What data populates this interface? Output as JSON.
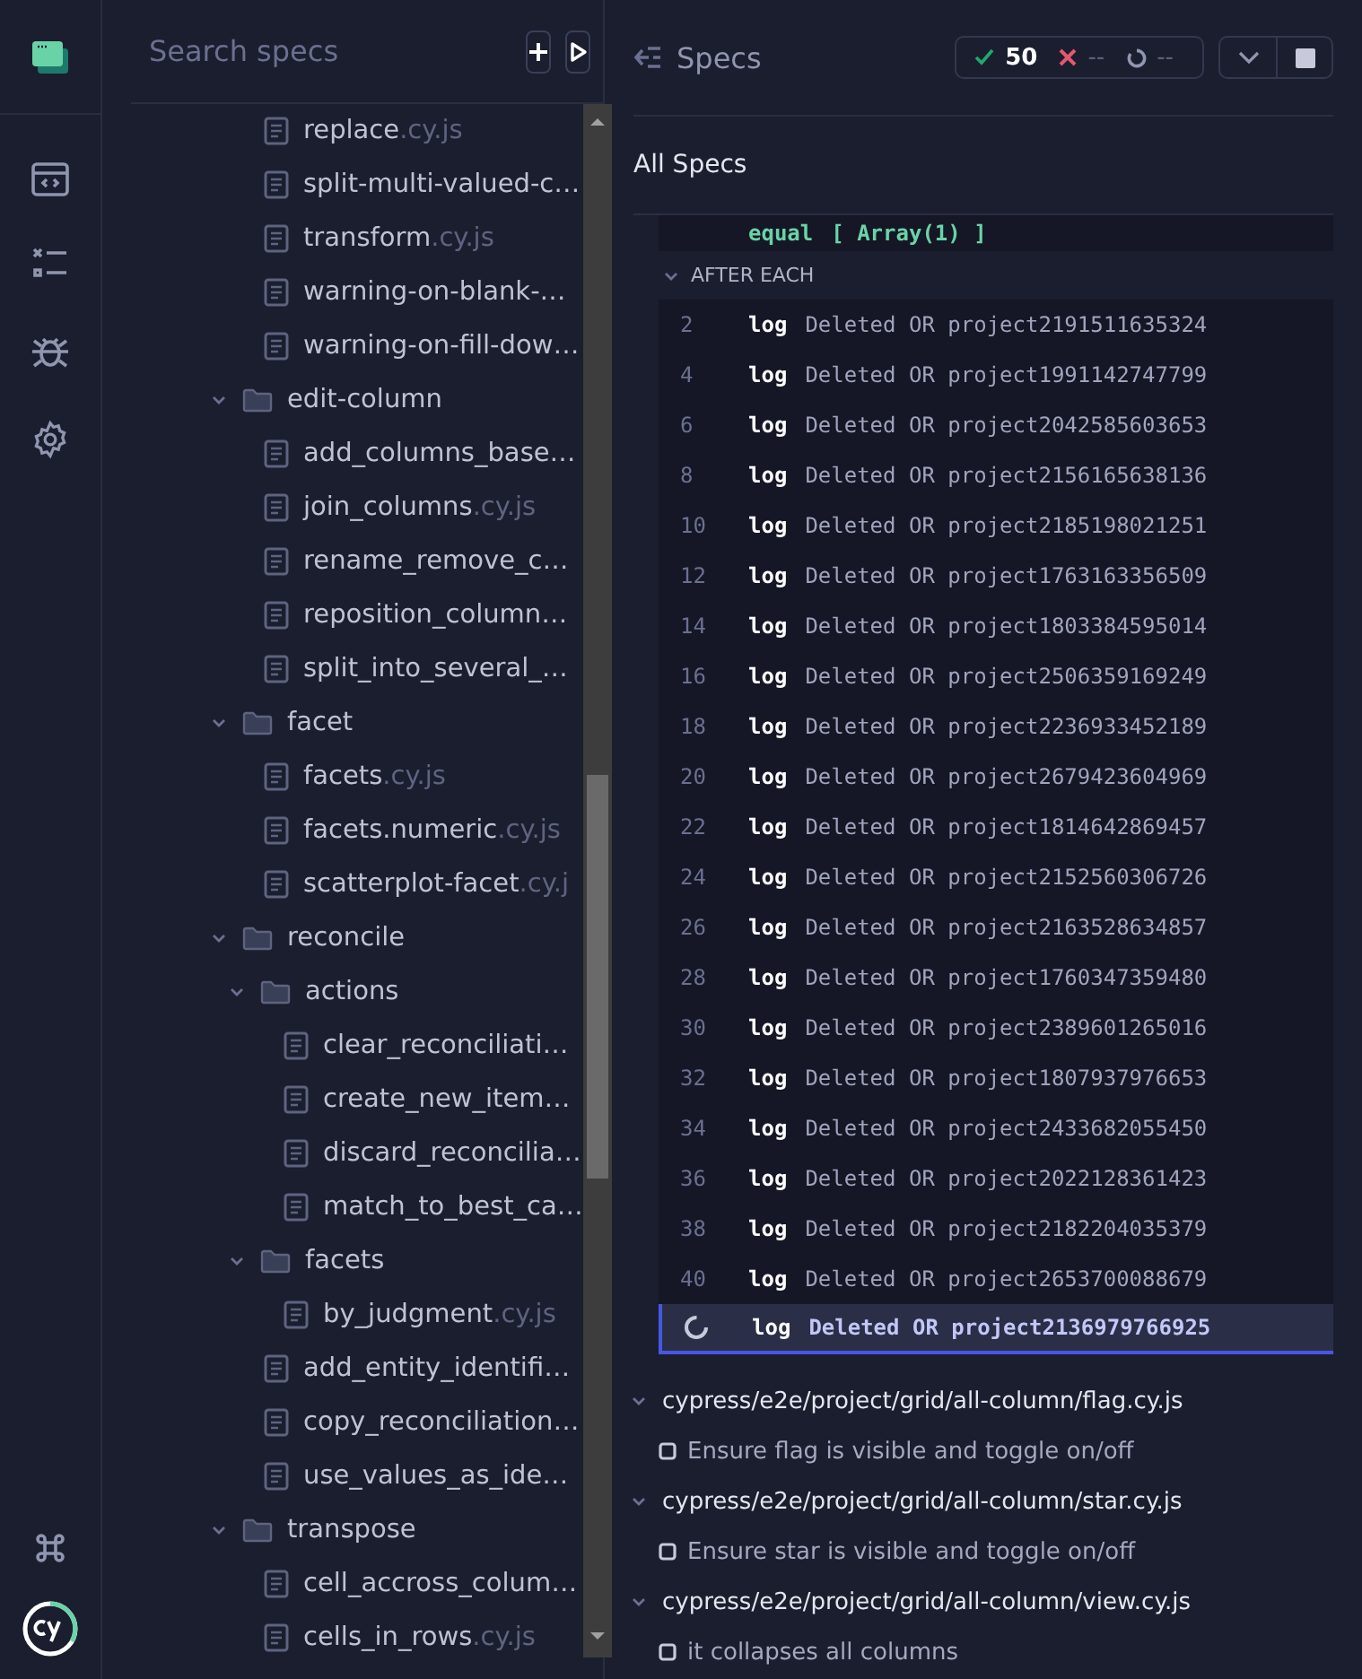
{
  "search": {
    "placeholder": "Search specs"
  },
  "tree": [
    {
      "kind": "file",
      "name": "replace",
      "ext": ".cy.js"
    },
    {
      "kind": "file",
      "name": "split-multi-valued-c…"
    },
    {
      "kind": "file",
      "name": "transform",
      "ext": ".cy.js"
    },
    {
      "kind": "file",
      "name": "warning-on-blank-…"
    },
    {
      "kind": "file",
      "name": "warning-on-fill-dow…"
    },
    {
      "kind": "folder",
      "name": "edit-column",
      "expanded": true,
      "children": [
        {
          "kind": "file",
          "name": "add_columns_base…"
        },
        {
          "kind": "file",
          "name": "join_columns",
          "ext": ".cy.js"
        },
        {
          "kind": "file",
          "name": "rename_remove_c…"
        },
        {
          "kind": "file",
          "name": "reposition_column…"
        },
        {
          "kind": "file",
          "name": "split_into_several_…"
        }
      ]
    },
    {
      "kind": "folder",
      "name": "facet",
      "expanded": true,
      "children": [
        {
          "kind": "file",
          "name": "facets",
          "ext": ".cy.js"
        },
        {
          "kind": "file",
          "name": "facets.numeric",
          "ext": ".cy.js"
        },
        {
          "kind": "file",
          "name": "scatterplot-facet",
          "ext": ".cy.j"
        }
      ]
    },
    {
      "kind": "folder",
      "name": "reconcile",
      "expanded": true,
      "children": [
        {
          "kind": "folder",
          "name": "actions",
          "expanded": true,
          "children": [
            {
              "kind": "file",
              "name": "clear_reconciliati…"
            },
            {
              "kind": "file",
              "name": "create_new_item…"
            },
            {
              "kind": "file",
              "name": "discard_reconcilia…"
            },
            {
              "kind": "file",
              "name": "match_to_best_ca…"
            }
          ]
        },
        {
          "kind": "folder",
          "name": "facets",
          "expanded": true,
          "children": [
            {
              "kind": "file",
              "name": "by_judgment",
              "ext": ".cy.js"
            }
          ]
        },
        {
          "kind": "file",
          "name": "add_entity_identifi…"
        },
        {
          "kind": "file",
          "name": "copy_reconciliation…"
        },
        {
          "kind": "file",
          "name": "use_values_as_ide…"
        }
      ]
    },
    {
      "kind": "folder",
      "name": "transpose",
      "expanded": true,
      "children": [
        {
          "kind": "file",
          "name": "cell_accross_colum…"
        },
        {
          "kind": "file",
          "name": "cells_in_rows",
          "ext": ".cy.js"
        }
      ]
    }
  ],
  "header": {
    "title": "Specs",
    "passed": "50",
    "failed": "--",
    "pending": "--"
  },
  "all_specs": "All Specs",
  "command_log": {
    "previous": {
      "command": "equal",
      "message": "[ Array(1) ]"
    },
    "hook": {
      "label": "AFTER EACH",
      "expanded": true
    },
    "rows": [
      {
        "number": "2",
        "command": "log",
        "message": "Deleted OR project2191511635324",
        "running": false
      },
      {
        "number": "4",
        "command": "log",
        "message": "Deleted OR project1991142747799",
        "running": false
      },
      {
        "number": "6",
        "command": "log",
        "message": "Deleted OR project2042585603653",
        "running": false
      },
      {
        "number": "8",
        "command": "log",
        "message": "Deleted OR project2156165638136",
        "running": false
      },
      {
        "number": "10",
        "command": "log",
        "message": "Deleted OR project2185198021251",
        "running": false
      },
      {
        "number": "12",
        "command": "log",
        "message": "Deleted OR project1763163356509",
        "running": false
      },
      {
        "number": "14",
        "command": "log",
        "message": "Deleted OR project1803384595014",
        "running": false
      },
      {
        "number": "16",
        "command": "log",
        "message": "Deleted OR project2506359169249",
        "running": false
      },
      {
        "number": "18",
        "command": "log",
        "message": "Deleted OR project2236933452189",
        "running": false
      },
      {
        "number": "20",
        "command": "log",
        "message": "Deleted OR project2679423604969",
        "running": false
      },
      {
        "number": "22",
        "command": "log",
        "message": "Deleted OR project1814642869457",
        "running": false
      },
      {
        "number": "24",
        "command": "log",
        "message": "Deleted OR project2152560306726",
        "running": false
      },
      {
        "number": "26",
        "command": "log",
        "message": "Deleted OR project2163528634857",
        "running": false
      },
      {
        "number": "28",
        "command": "log",
        "message": "Deleted OR project1760347359480",
        "running": false
      },
      {
        "number": "30",
        "command": "log",
        "message": "Deleted OR project2389601265016",
        "running": false
      },
      {
        "number": "32",
        "command": "log",
        "message": "Deleted OR project1807937976653",
        "running": false
      },
      {
        "number": "34",
        "command": "log",
        "message": "Deleted OR project2433682055450",
        "running": false
      },
      {
        "number": "36",
        "command": "log",
        "message": "Deleted OR project2022128361423",
        "running": false
      },
      {
        "number": "38",
        "command": "log",
        "message": "Deleted OR project2182204035379",
        "running": false
      },
      {
        "number": "40",
        "command": "log",
        "message": "Deleted OR project2653700088679",
        "running": false
      },
      {
        "command": "log",
        "message": "Deleted OR project2136979766925",
        "running": true
      }
    ]
  },
  "specs": [
    {
      "path": "cypress/e2e/project/grid/all-column/flag.cy.js",
      "expanded": true,
      "tests": [
        "Ensure flag is visible and toggle on/off"
      ]
    },
    {
      "path": "cypress/e2e/project/grid/all-column/star.cy.js",
      "expanded": true,
      "tests": [
        "Ensure star is visible and toggle on/off"
      ]
    },
    {
      "path": "cypress/e2e/project/grid/all-column/view.cy.js",
      "expanded": true,
      "tests": [
        "it collapses all columns"
      ]
    }
  ]
}
